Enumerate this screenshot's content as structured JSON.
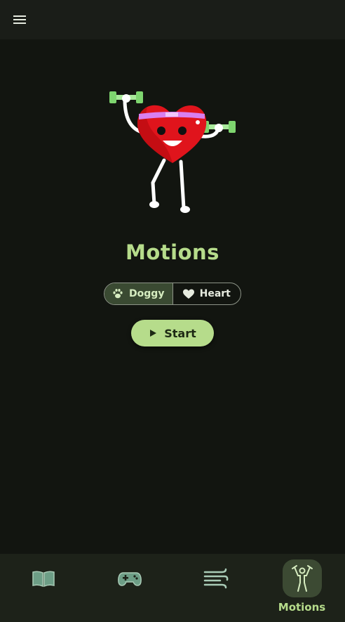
{
  "app": {
    "title": "Motions"
  },
  "mode_toggle": {
    "options": [
      {
        "label": "Doggy",
        "icon": "paw-icon",
        "selected": true
      },
      {
        "label": "Heart",
        "icon": "heart-icon",
        "selected": false
      }
    ]
  },
  "start_button": {
    "label": "Start",
    "icon": "play-icon"
  },
  "bottom_nav": {
    "items": [
      {
        "icon": "book-icon",
        "label": "",
        "active": false
      },
      {
        "icon": "gamepad-icon",
        "label": "",
        "active": false
      },
      {
        "icon": "wind-icon",
        "label": "",
        "active": false
      },
      {
        "icon": "exercise-icon",
        "label": "Motions",
        "active": true
      }
    ]
  },
  "colors": {
    "accent": "#b6dc8b",
    "background": "#121510",
    "nav_background": "#1d2219",
    "active_pill": "#3c4a33"
  }
}
